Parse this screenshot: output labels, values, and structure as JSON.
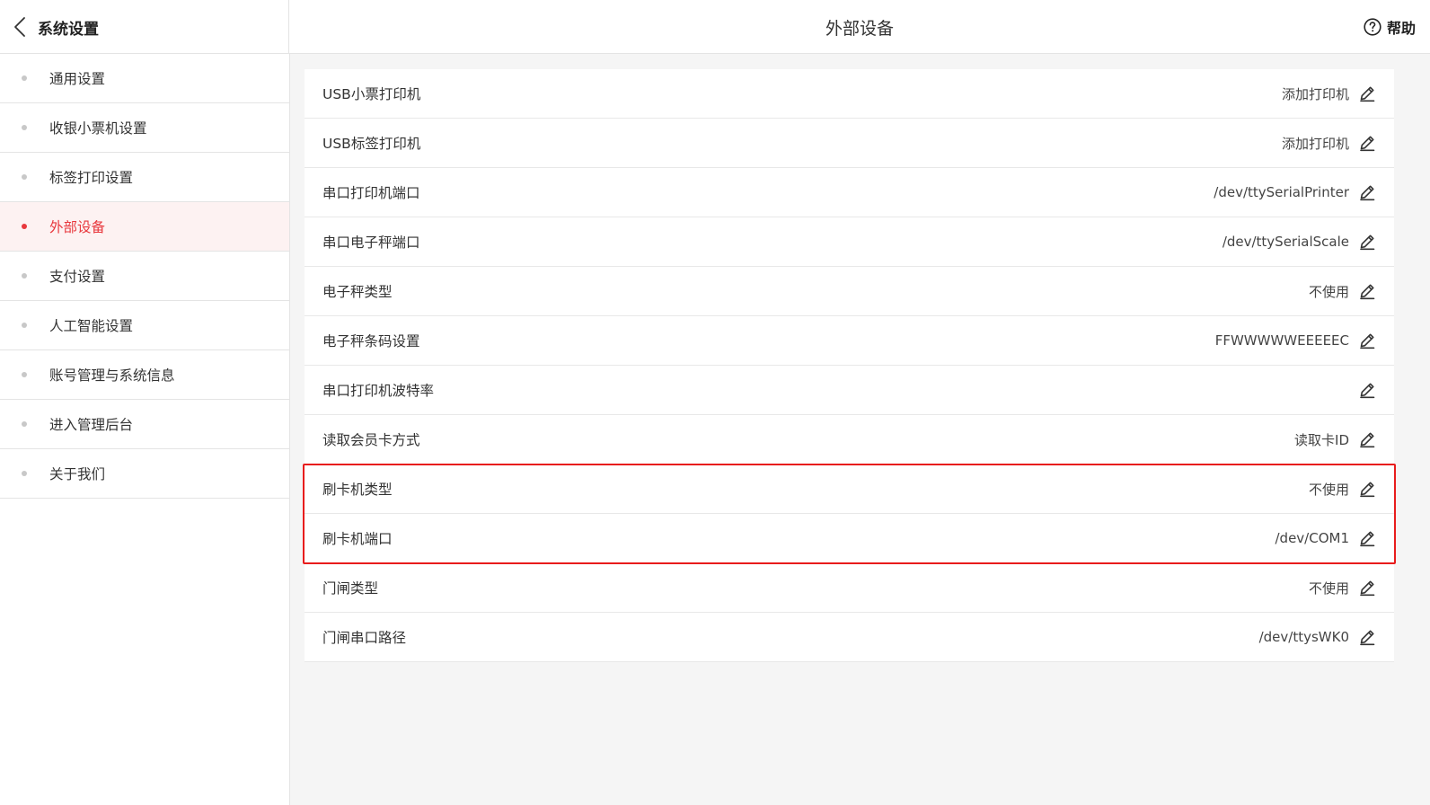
{
  "header": {
    "back_title": "系统设置",
    "page_title": "外部设备",
    "help_label": "帮助"
  },
  "sidebar": {
    "items": [
      {
        "label": "通用设置",
        "active": false
      },
      {
        "label": "收银小票机设置",
        "active": false
      },
      {
        "label": "标签打印设置",
        "active": false
      },
      {
        "label": "外部设备",
        "active": true
      },
      {
        "label": "支付设置",
        "active": false
      },
      {
        "label": "人工智能设置",
        "active": false
      },
      {
        "label": "账号管理与系统信息",
        "active": false
      },
      {
        "label": "进入管理后台",
        "active": false
      },
      {
        "label": "关于我们",
        "active": false
      }
    ]
  },
  "settings": {
    "rows": [
      {
        "label": "USB小票打印机",
        "value": "添加打印机"
      },
      {
        "label": "USB标签打印机",
        "value": "添加打印机"
      },
      {
        "label": "串口打印机端口",
        "value": "/dev/ttySerialPrinter"
      },
      {
        "label": "串口电子秤端口",
        "value": "/dev/ttySerialScale"
      },
      {
        "label": "电子秤类型",
        "value": "不使用"
      },
      {
        "label": "电子秤条码设置",
        "value": "FFWWWWWEEEEEC"
      },
      {
        "label": "串口打印机波特率",
        "value": ""
      },
      {
        "label": "读取会员卡方式",
        "value": "读取卡ID"
      },
      {
        "label": "刷卡机类型",
        "value": "不使用"
      },
      {
        "label": "刷卡机端口",
        "value": "/dev/COM1"
      },
      {
        "label": "门闸类型",
        "value": "不使用"
      },
      {
        "label": "门闸串口路径",
        "value": "/dev/ttysWK0"
      }
    ]
  },
  "colors": {
    "accent": "#e8383d",
    "highlight_border": "#e81c1c",
    "main_background": "#f5f5f5"
  },
  "icons": {
    "back": "chevron-left-icon",
    "help": "question-circle-icon",
    "edit": "pencil-icon"
  }
}
